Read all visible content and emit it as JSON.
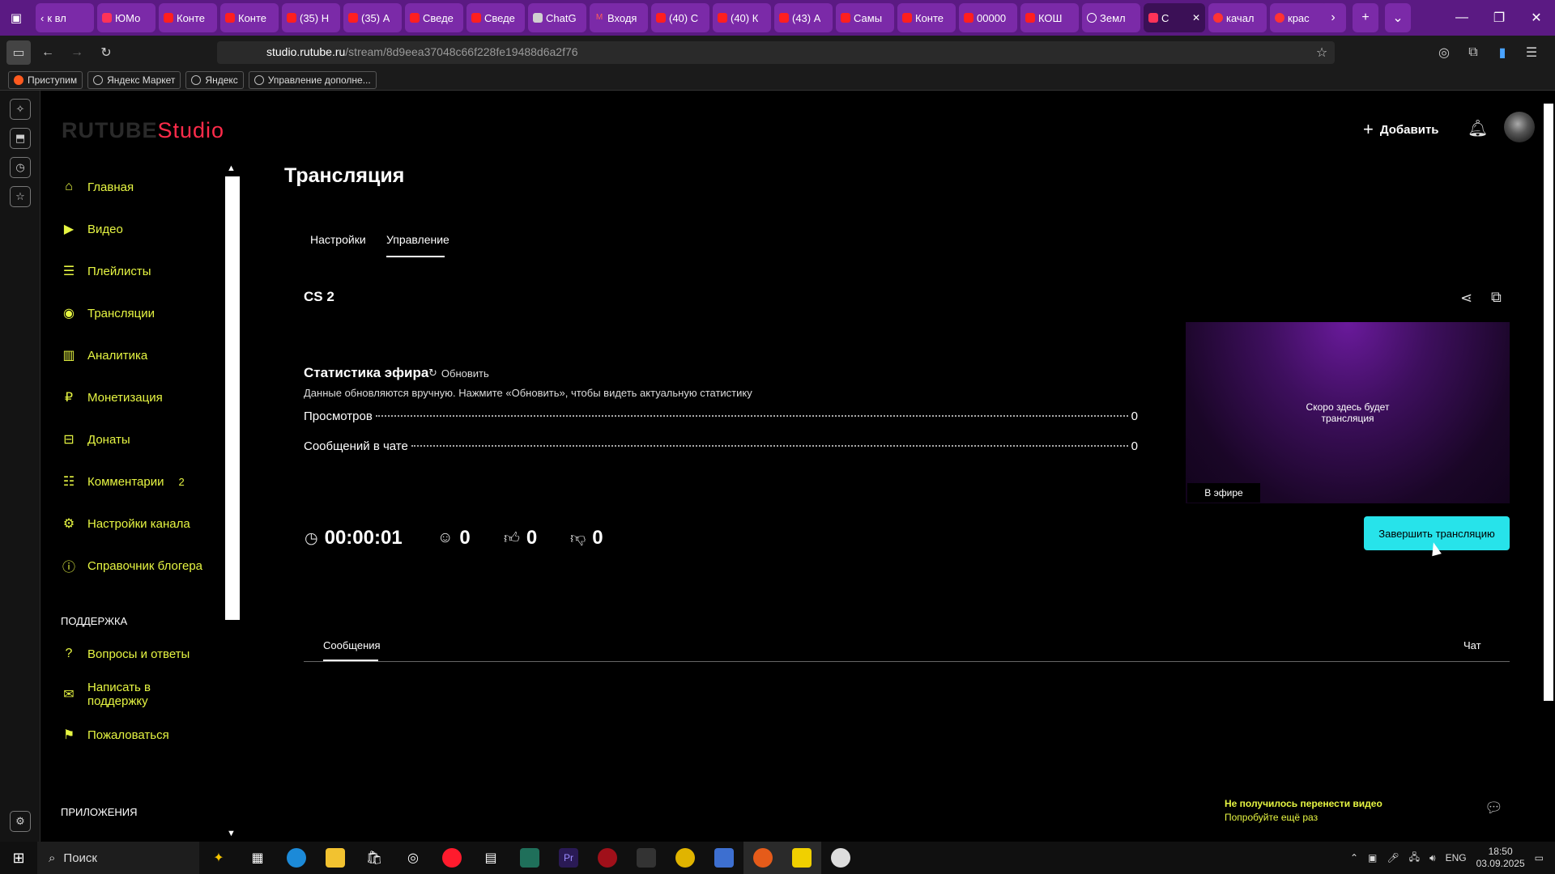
{
  "browser": {
    "tabs": [
      {
        "label": "к вл",
        "favicon": "back-icon",
        "fav_class": "none"
      },
      {
        "label": "ЮМо",
        "favicon": "yoomoney-icon",
        "fav_class": "rs"
      },
      {
        "label": "Конте",
        "favicon": "youtube-icon",
        "fav_class": ""
      },
      {
        "label": "Конте",
        "favicon": "youtube-icon",
        "fav_class": ""
      },
      {
        "label": "(35) Н",
        "favicon": "youtube-icon",
        "fav_class": ""
      },
      {
        "label": "(35) А",
        "favicon": "youtube-icon",
        "fav_class": ""
      },
      {
        "label": "Сведе",
        "favicon": "youtube-icon",
        "fav_class": ""
      },
      {
        "label": "Сведе",
        "favicon": "youtube-icon",
        "fav_class": ""
      },
      {
        "label": "ChatG",
        "favicon": "chatgpt-icon",
        "fav_class": "green"
      },
      {
        "label": "Входя",
        "favicon": "gmail-icon",
        "fav_class": "mail"
      },
      {
        "label": "(40) С",
        "favicon": "youtube-icon",
        "fav_class": ""
      },
      {
        "label": "(40) К",
        "favicon": "youtube-icon",
        "fav_class": ""
      },
      {
        "label": "(43) А",
        "favicon": "youtube-icon",
        "fav_class": ""
      },
      {
        "label": "Самы",
        "favicon": "youtube-icon",
        "fav_class": ""
      },
      {
        "label": "Конте",
        "favicon": "youtube-icon",
        "fav_class": ""
      },
      {
        "label": "00000",
        "favicon": "youtube-icon",
        "fav_class": ""
      },
      {
        "label": "КОШ",
        "favicon": "youtube-icon",
        "fav_class": ""
      },
      {
        "label": "Земл",
        "favicon": "info-icon",
        "fav_class": "info"
      },
      {
        "label": "С",
        "favicon": "rutube-studio-icon",
        "fav_class": "rs",
        "active": true
      },
      {
        "label": "качал",
        "favicon": "yandex-icon",
        "fav_class": "ya"
      },
      {
        "label": "крас",
        "favicon": "yandex-icon",
        "fav_class": "ya"
      }
    ],
    "url_host": "studio.rutube.ru",
    "url_path": "/stream/8d9eea37048c66f228fe19488d6a2f76",
    "bookmarks": [
      "Приступим",
      "Яндекс Маркет",
      "Яндекс",
      "Управление дополне..."
    ]
  },
  "app": {
    "logo_main": "RUTUBE",
    "logo_sub": "Studio",
    "add_label": "Добавить",
    "nav": [
      {
        "label": "Главная",
        "icon": "home-icon",
        "glyph": "⌂"
      },
      {
        "label": "Видео",
        "icon": "video-icon",
        "glyph": "▶"
      },
      {
        "label": "Плейлисты",
        "icon": "playlist-icon",
        "glyph": "☰"
      },
      {
        "label": "Трансляции",
        "icon": "broadcast-icon",
        "glyph": "◉"
      },
      {
        "label": "Аналитика",
        "icon": "analytics-icon",
        "glyph": "▥"
      },
      {
        "label": "Монетизация",
        "icon": "monetization-icon",
        "glyph": "₽"
      },
      {
        "label": "Донаты",
        "icon": "donate-icon",
        "glyph": "⊟"
      },
      {
        "label": "Комментарии",
        "icon": "comments-icon",
        "glyph": "☷",
        "badge": "2"
      },
      {
        "label": "Настройки канала",
        "icon": "settings-icon",
        "glyph": "⚙"
      },
      {
        "label": "Справочник блогера",
        "icon": "info-icon",
        "glyph": "ⓘ"
      }
    ],
    "support_title": "ПОДДЕРЖКА",
    "support_nav": [
      {
        "label": "Вопросы и ответы",
        "icon": "help-icon",
        "glyph": "?"
      },
      {
        "label": "Написать в поддержку",
        "icon": "mail-icon",
        "glyph": "✉"
      },
      {
        "label": "Пожаловаться",
        "icon": "flag-icon",
        "glyph": "⚑"
      }
    ],
    "apps_title": "ПРИЛОЖЕНИЯ"
  },
  "main": {
    "page_title": "Трансляция",
    "tabs": [
      "Настройки",
      "Управление"
    ],
    "active_tab": "Управление",
    "stream_name": "CS 2",
    "stats_title": "Статистика эфира",
    "refresh_label": "Обновить",
    "stats_note": "Данные обновляются вручную. Нажмите «Обновить», чтобы видеть актуальную статистику",
    "stats": [
      {
        "label": "Просмотров",
        "value": "0"
      },
      {
        "label": "Сообщений в чате",
        "value": "0"
      }
    ],
    "counters": {
      "duration": "00:00:01",
      "viewers": "0",
      "likes": "0",
      "dislikes": "0"
    },
    "preview_text": "Скоро здесь будет трансляция",
    "live_label": "В эфире",
    "end_button": "Завершить трансляцию",
    "messages_tab": "Сообщения",
    "chat_label": "Чат"
  },
  "toast": {
    "line1": "Не получилось перенести видео",
    "line2": "Попробуйте ещё раз"
  },
  "taskbar": {
    "search_label": "Поиск",
    "lang": "ENG",
    "time": "18:50",
    "date": "03.09.2025"
  },
  "colors": {
    "accent": "#e6f542",
    "button": "#27e3ea",
    "tabbar": "#5b1a83",
    "logo_studio": "#ff2b4a"
  }
}
